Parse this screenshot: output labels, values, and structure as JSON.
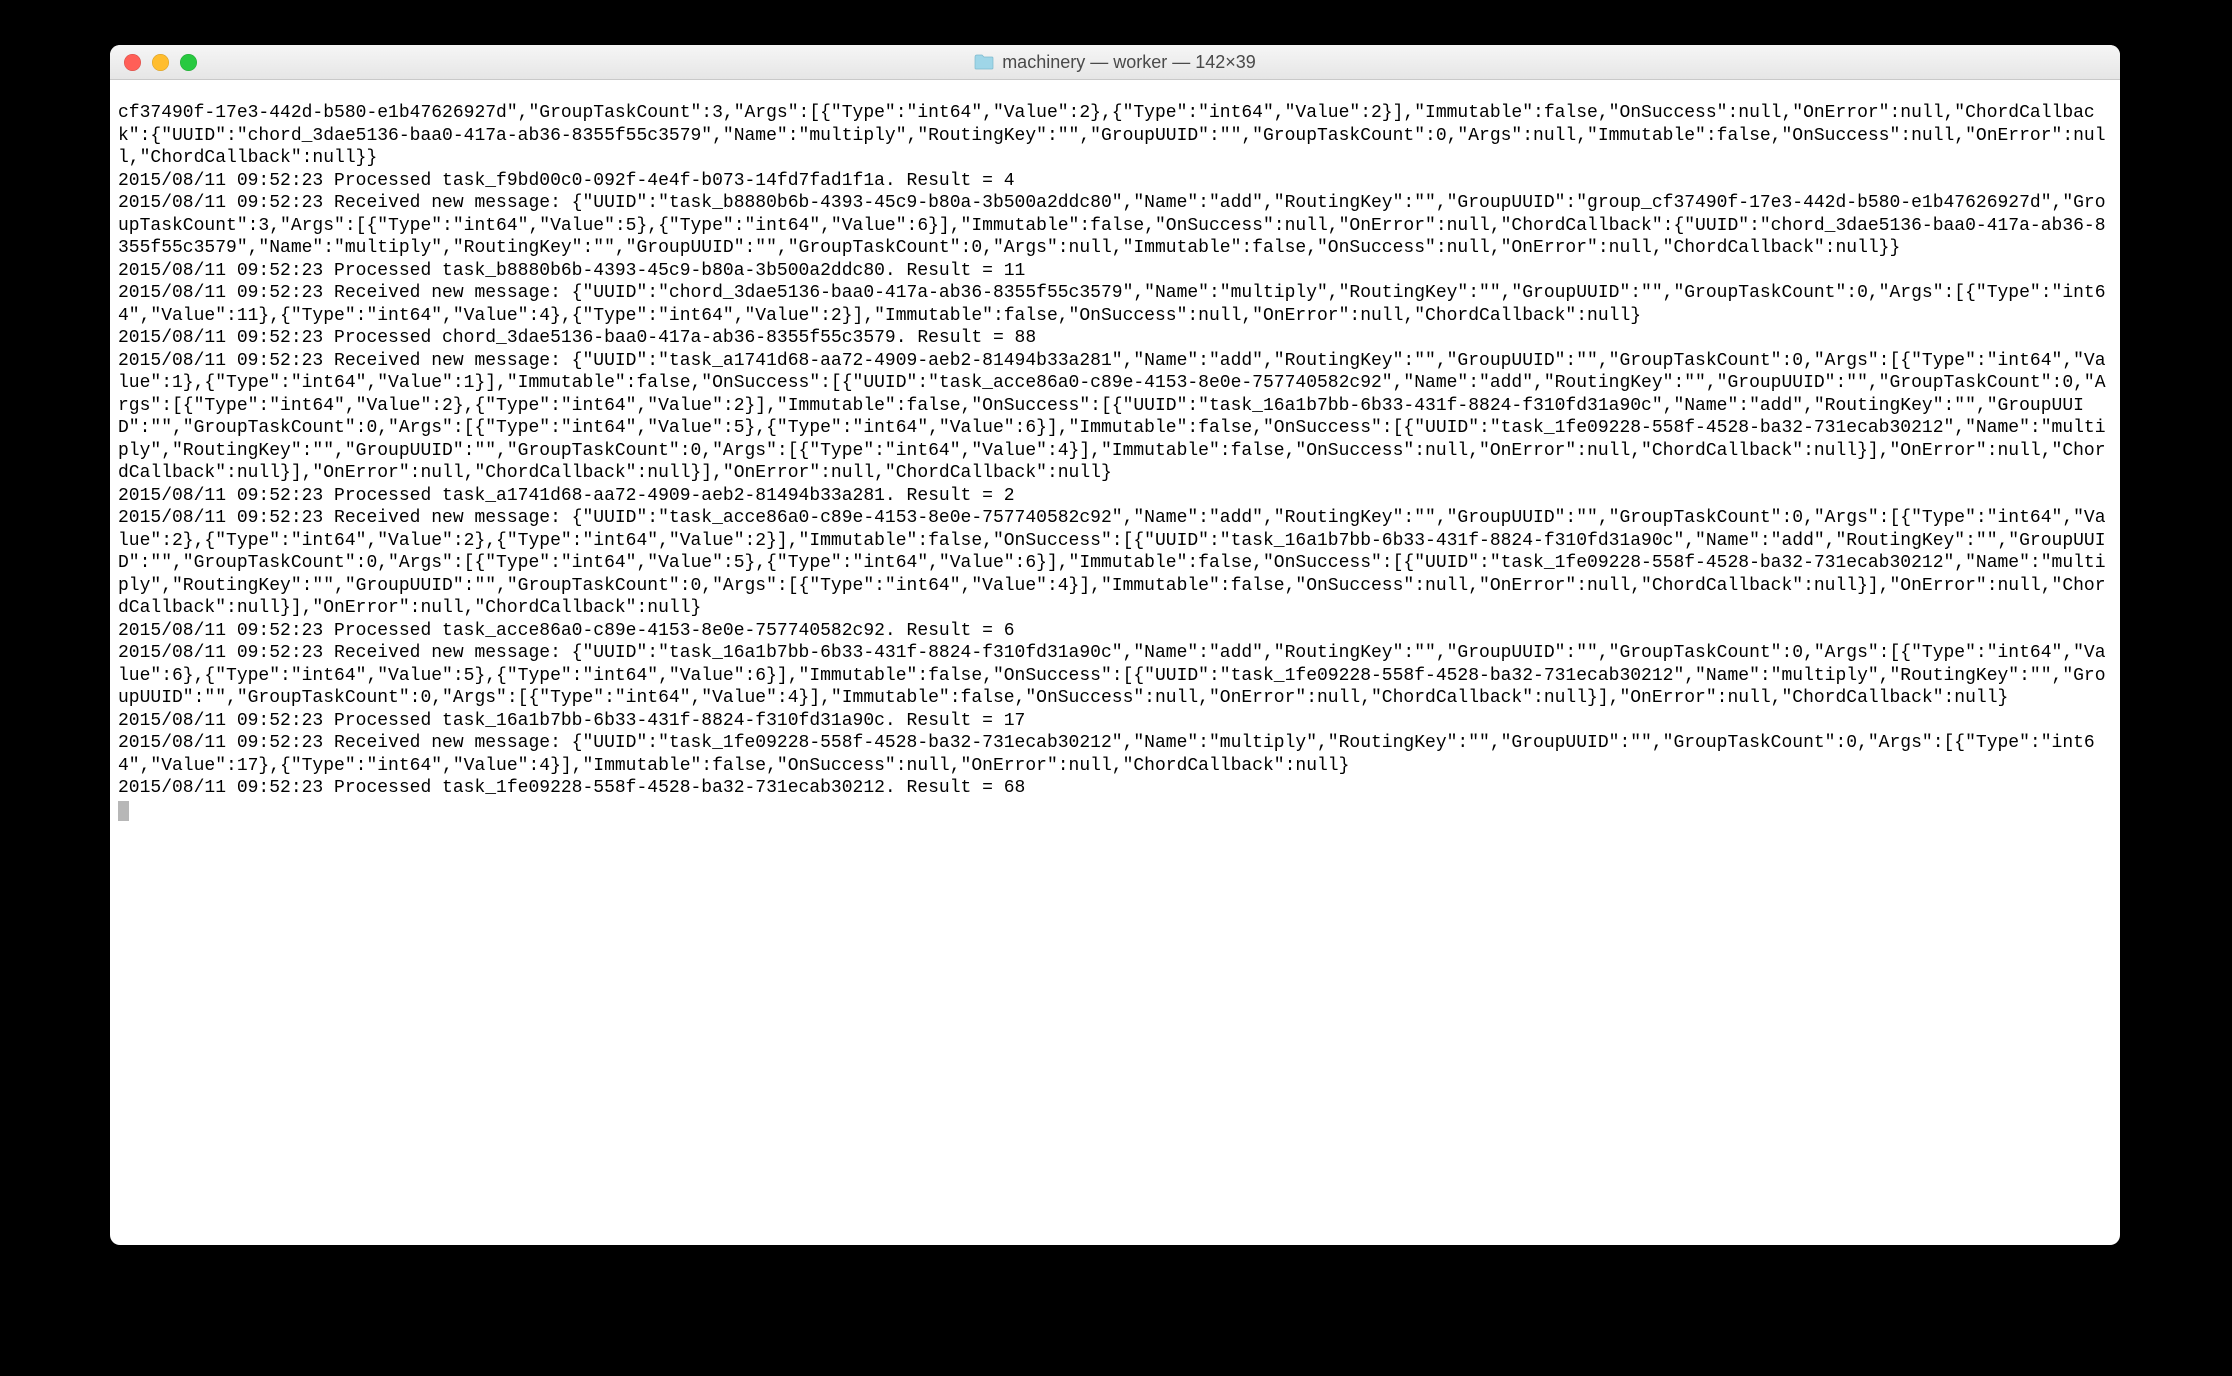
{
  "window": {
    "title": "machinery — worker — 142×39"
  },
  "terminal": {
    "lines": [
      "cf37490f-17e3-442d-b580-e1b47626927d\",\"GroupTaskCount\":3,\"Args\":[{\"Type\":\"int64\",\"Value\":2},{\"Type\":\"int64\",\"Value\":2}],\"Immutable\":false,\"OnSuccess\":null,\"OnError\":null,\"ChordCallback\":{\"UUID\":\"chord_3dae5136-baa0-417a-ab36-8355f55c3579\",\"Name\":\"multiply\",\"RoutingKey\":\"\",\"GroupUUID\":\"\",\"GroupTaskCount\":0,\"Args\":null,\"Immutable\":false,\"OnSuccess\":null,\"OnError\":null,\"ChordCallback\":null}}",
      "2015/08/11 09:52:23 Processed task_f9bd00c0-092f-4e4f-b073-14fd7fad1f1a. Result = 4",
      "2015/08/11 09:52:23 Received new message: {\"UUID\":\"task_b8880b6b-4393-45c9-b80a-3b500a2ddc80\",\"Name\":\"add\",\"RoutingKey\":\"\",\"GroupUUID\":\"group_cf37490f-17e3-442d-b580-e1b47626927d\",\"GroupTaskCount\":3,\"Args\":[{\"Type\":\"int64\",\"Value\":5},{\"Type\":\"int64\",\"Value\":6}],\"Immutable\":false,\"OnSuccess\":null,\"OnError\":null,\"ChordCallback\":{\"UUID\":\"chord_3dae5136-baa0-417a-ab36-8355f55c3579\",\"Name\":\"multiply\",\"RoutingKey\":\"\",\"GroupUUID\":\"\",\"GroupTaskCount\":0,\"Args\":null,\"Immutable\":false,\"OnSuccess\":null,\"OnError\":null,\"ChordCallback\":null}}",
      "2015/08/11 09:52:23 Processed task_b8880b6b-4393-45c9-b80a-3b500a2ddc80. Result = 11",
      "2015/08/11 09:52:23 Received new message: {\"UUID\":\"chord_3dae5136-baa0-417a-ab36-8355f55c3579\",\"Name\":\"multiply\",\"RoutingKey\":\"\",\"GroupUUID\":\"\",\"GroupTaskCount\":0,\"Args\":[{\"Type\":\"int64\",\"Value\":11},{\"Type\":\"int64\",\"Value\":4},{\"Type\":\"int64\",\"Value\":2}],\"Immutable\":false,\"OnSuccess\":null,\"OnError\":null,\"ChordCallback\":null}",
      "2015/08/11 09:52:23 Processed chord_3dae5136-baa0-417a-ab36-8355f55c3579. Result = 88",
      "2015/08/11 09:52:23 Received new message: {\"UUID\":\"task_a1741d68-aa72-4909-aeb2-81494b33a281\",\"Name\":\"add\",\"RoutingKey\":\"\",\"GroupUUID\":\"\",\"GroupTaskCount\":0,\"Args\":[{\"Type\":\"int64\",\"Value\":1},{\"Type\":\"int64\",\"Value\":1}],\"Immutable\":false,\"OnSuccess\":[{\"UUID\":\"task_acce86a0-c89e-4153-8e0e-757740582c92\",\"Name\":\"add\",\"RoutingKey\":\"\",\"GroupUUID\":\"\",\"GroupTaskCount\":0,\"Args\":[{\"Type\":\"int64\",\"Value\":2},{\"Type\":\"int64\",\"Value\":2}],\"Immutable\":false,\"OnSuccess\":[{\"UUID\":\"task_16a1b7bb-6b33-431f-8824-f310fd31a90c\",\"Name\":\"add\",\"RoutingKey\":\"\",\"GroupUUID\":\"\",\"GroupTaskCount\":0,\"Args\":[{\"Type\":\"int64\",\"Value\":5},{\"Type\":\"int64\",\"Value\":6}],\"Immutable\":false,\"OnSuccess\":[{\"UUID\":\"task_1fe09228-558f-4528-ba32-731ecab30212\",\"Name\":\"multiply\",\"RoutingKey\":\"\",\"GroupUUID\":\"\",\"GroupTaskCount\":0,\"Args\":[{\"Type\":\"int64\",\"Value\":4}],\"Immutable\":false,\"OnSuccess\":null,\"OnError\":null,\"ChordCallback\":null}],\"OnError\":null,\"ChordCallback\":null}],\"OnError\":null,\"ChordCallback\":null}],\"OnError\":null,\"ChordCallback\":null}",
      "2015/08/11 09:52:23 Processed task_a1741d68-aa72-4909-aeb2-81494b33a281. Result = 2",
      "2015/08/11 09:52:23 Received new message: {\"UUID\":\"task_acce86a0-c89e-4153-8e0e-757740582c92\",\"Name\":\"add\",\"RoutingKey\":\"\",\"GroupUUID\":\"\",\"GroupTaskCount\":0,\"Args\":[{\"Type\":\"int64\",\"Value\":2},{\"Type\":\"int64\",\"Value\":2},{\"Type\":\"int64\",\"Value\":2}],\"Immutable\":false,\"OnSuccess\":[{\"UUID\":\"task_16a1b7bb-6b33-431f-8824-f310fd31a90c\",\"Name\":\"add\",\"RoutingKey\":\"\",\"GroupUUID\":\"\",\"GroupTaskCount\":0,\"Args\":[{\"Type\":\"int64\",\"Value\":5},{\"Type\":\"int64\",\"Value\":6}],\"Immutable\":false,\"OnSuccess\":[{\"UUID\":\"task_1fe09228-558f-4528-ba32-731ecab30212\",\"Name\":\"multiply\",\"RoutingKey\":\"\",\"GroupUUID\":\"\",\"GroupTaskCount\":0,\"Args\":[{\"Type\":\"int64\",\"Value\":4}],\"Immutable\":false,\"OnSuccess\":null,\"OnError\":null,\"ChordCallback\":null}],\"OnError\":null,\"ChordCallback\":null}],\"OnError\":null,\"ChordCallback\":null}",
      "2015/08/11 09:52:23 Processed task_acce86a0-c89e-4153-8e0e-757740582c92. Result = 6",
      "2015/08/11 09:52:23 Received new message: {\"UUID\":\"task_16a1b7bb-6b33-431f-8824-f310fd31a90c\",\"Name\":\"add\",\"RoutingKey\":\"\",\"GroupUUID\":\"\",\"GroupTaskCount\":0,\"Args\":[{\"Type\":\"int64\",\"Value\":6},{\"Type\":\"int64\",\"Value\":5},{\"Type\":\"int64\",\"Value\":6}],\"Immutable\":false,\"OnSuccess\":[{\"UUID\":\"task_1fe09228-558f-4528-ba32-731ecab30212\",\"Name\":\"multiply\",\"RoutingKey\":\"\",\"GroupUUID\":\"\",\"GroupTaskCount\":0,\"Args\":[{\"Type\":\"int64\",\"Value\":4}],\"Immutable\":false,\"OnSuccess\":null,\"OnError\":null,\"ChordCallback\":null}],\"OnError\":null,\"ChordCallback\":null}",
      "2015/08/11 09:52:23 Processed task_16a1b7bb-6b33-431f-8824-f310fd31a90c. Result = 17",
      "2015/08/11 09:52:23 Received new message: {\"UUID\":\"task_1fe09228-558f-4528-ba32-731ecab30212\",\"Name\":\"multiply\",\"RoutingKey\":\"\",\"GroupUUID\":\"\",\"GroupTaskCount\":0,\"Args\":[{\"Type\":\"int64\",\"Value\":17},{\"Type\":\"int64\",\"Value\":4}],\"Immutable\":false,\"OnSuccess\":null,\"OnError\":null,\"ChordCallback\":null}",
      "2015/08/11 09:52:23 Processed task_1fe09228-558f-4528-ba32-731ecab30212. Result = 68"
    ]
  }
}
